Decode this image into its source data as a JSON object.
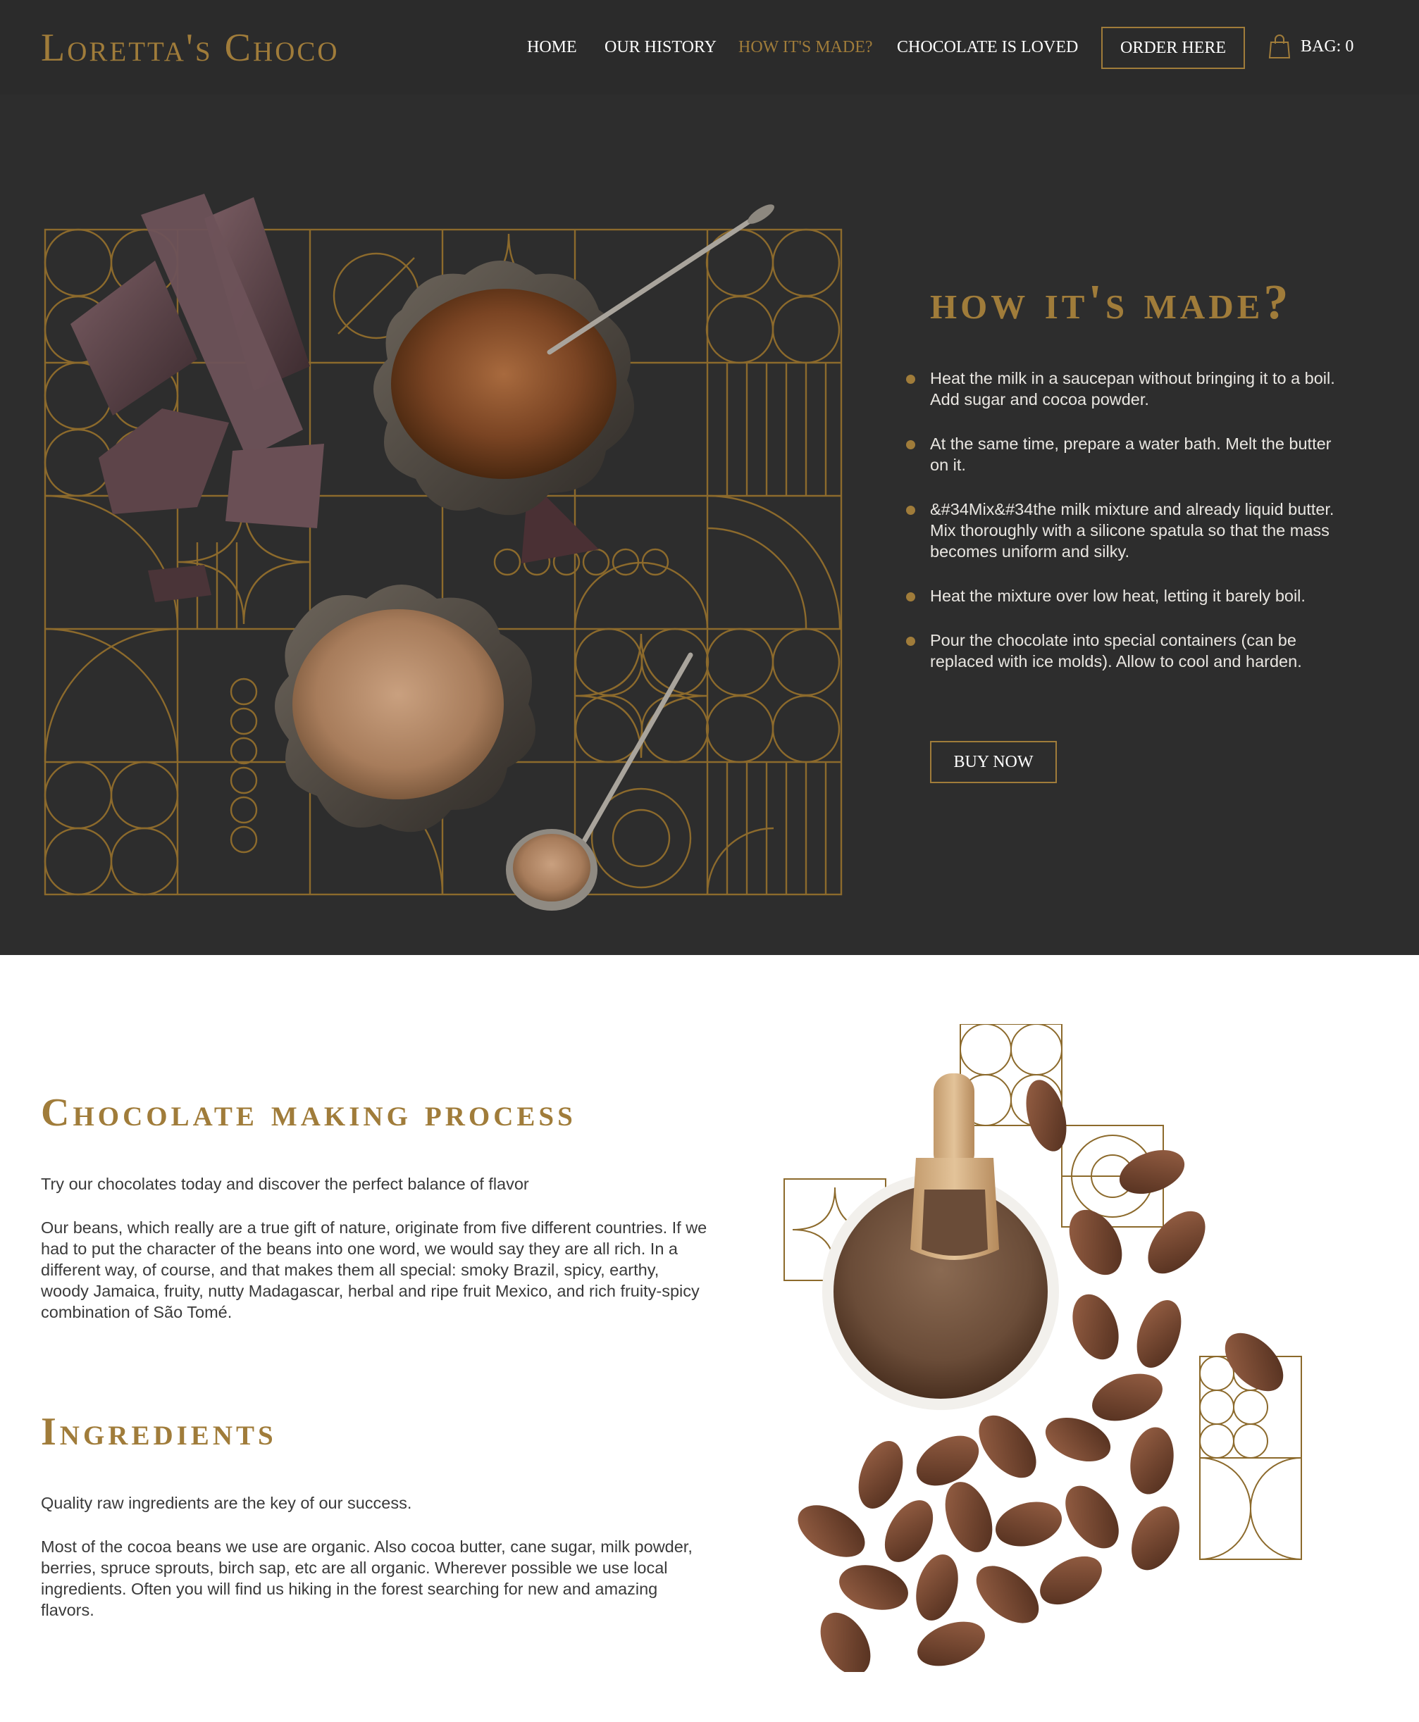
{
  "brand": {
    "logo_text": "Loretta's Choco",
    "accent_color": "#a07c3a",
    "dark_bg": "#2d2d2d"
  },
  "nav": {
    "items": [
      {
        "label": "HOME",
        "active": false
      },
      {
        "label": "OUR HISTORY",
        "active": false
      },
      {
        "label": "HOW IT'S MADE?",
        "active": true
      },
      {
        "label": "CHOCOLATE IS LOVED",
        "active": false
      }
    ],
    "order_label": "ORDER HERE",
    "bag_label": "BAG: 0",
    "bag_icon": "shopping-bag-icon"
  },
  "hero": {
    "title": "how it's made?",
    "steps": [
      "Heat the milk in a saucepan without bringing it to a boil. Add sugar and cocoa powder.",
      "At the same time, prepare a water bath. Melt the butter on it.",
      "&#34Mix&#34the milk mixture and already liquid butter. Mix thoroughly with a silicone spatula so that the mass becomes uniform and silky.",
      "Heat the mixture over low heat, letting it barely boil.",
      "Pour the chocolate into special containers (can be replaced with ice molds). Allow to cool and harden."
    ],
    "buy_label": "BUY NOW"
  },
  "process": {
    "title": "Chocolate making process",
    "intro": "Try our chocolates today and discover the perfect balance of flavor",
    "body": "Our beans, which really are a true gift of nature, originate from five different countries. If we had to put the character of the beans into one word, we would say they are all rich. In a different way, of course, and that makes them all special: smoky Brazil, spicy, earthy, woody Jamaica, fruity, nutty Madagascar, herbal and ripe fruit Mexico, and rich fruity-spicy combination of São Tomé."
  },
  "ingredients": {
    "title": "Ingredients",
    "intro": "Quality raw ingredients are the key of our success.",
    "body": "Most of the cocoa beans we use are organic. Also cocoa butter, cane sugar, milk powder, berries, spruce sprouts, birch sap, etc are all organic. Wherever possible we use local ingredients. Often you will find us hiking in the forest searching for new and amazing flavors."
  }
}
